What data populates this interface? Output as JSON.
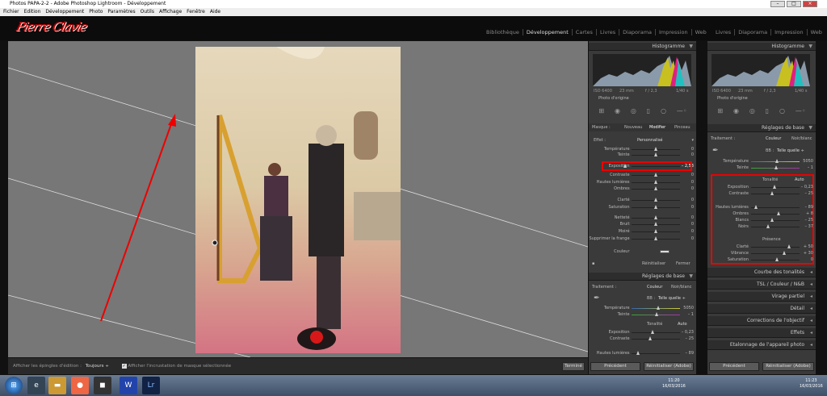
{
  "window": {
    "title": "Photos PAPA-2-2 - Adobe Photoshop Lightroom - Développement"
  },
  "menu": [
    "Fichier",
    "Edition",
    "Développement",
    "Photo",
    "Paramètres",
    "Outils",
    "Affichage",
    "Fenêtre",
    "Aide"
  ],
  "identity": {
    "plate": "Pierre Clavie"
  },
  "modules_left": [
    "Bibliothèque",
    "Développement",
    "Cartes",
    "Livres",
    "Diaporama",
    "Impression",
    "Web"
  ],
  "modules_right": [
    "Livres",
    "Diaporama",
    "Impression",
    "Web"
  ],
  "histogram": {
    "title": "Histogramme",
    "iso": "ISO 6400",
    "focal": "23 mm",
    "aperture": "f / 2,3",
    "shutter": "1/40 s",
    "original": "Photo d'origine"
  },
  "mask_panel": {
    "tabs": [
      "Masque :",
      "Nouveau",
      "Modifier",
      "Pinceau"
    ],
    "effect_label": "Effet :",
    "effect_value": "Personnalisé",
    "sliders": [
      {
        "label": "Température",
        "value": "0"
      },
      {
        "label": "Teinte",
        "value": "0"
      },
      {
        "label": "Exposition",
        "value": "– 2,53"
      },
      {
        "label": "Contraste",
        "value": "0"
      },
      {
        "label": "Hautes lumières",
        "value": "0"
      },
      {
        "label": "Ombres",
        "value": "0"
      },
      {
        "label": "Clarté",
        "value": "0"
      },
      {
        "label": "Saturation",
        "value": "0"
      },
      {
        "label": "Netteté",
        "value": "0"
      },
      {
        "label": "Bruit",
        "value": "0"
      },
      {
        "label": "Moiré",
        "value": "0"
      },
      {
        "label": "Supprimer la frange",
        "value": "0"
      }
    ],
    "couleur": "Couleur",
    "reset": "Réinitialiser",
    "close": "Fermer"
  },
  "basic_left": {
    "title": "Réglages de base",
    "treatment": "Traitement :",
    "color": "Couleur",
    "bw": "Noir/blanc",
    "wb_label": "BB :",
    "wb_value": "Telle quelle ÷",
    "temp_label": "Température",
    "temp_value": "5050",
    "tint_label": "Teinte",
    "tint_value": "– 1",
    "tone": "Tonalité",
    "auto": "Auto",
    "expo_label": "Exposition",
    "expo_value": "– 0,23",
    "contrast_label": "Contraste",
    "contrast_value": "– 25",
    "highlights_label": "Hautes lumières",
    "highlights_value": "– 89"
  },
  "basic_right": {
    "title": "Réglages de base",
    "treatment": "Traitement :",
    "color": "Couleur",
    "bw": "Noir/blanc",
    "wb_label": "BB :",
    "wb_value": "Telle quelle ÷",
    "temp_label": "Température",
    "temp_value": "5050",
    "tint_label": "Teinte",
    "tint_value": "– 1",
    "tone": "Tonalité",
    "auto": "Auto",
    "sliders": [
      {
        "label": "Exposition",
        "value": "– 0,23",
        "pos": 0.45
      },
      {
        "label": "Contraste",
        "value": "– 25",
        "pos": 0.4
      },
      {
        "label": "Hautes lumières",
        "value": "– 89",
        "pos": 0.08
      },
      {
        "label": "Ombres",
        "value": "+ 8",
        "pos": 0.54
      },
      {
        "label": "Blancs",
        "value": "– 25",
        "pos": 0.4
      },
      {
        "label": "Noirs",
        "value": "– 37",
        "pos": 0.32
      }
    ],
    "presence": "Présence",
    "presence_sliders": [
      {
        "label": "Clarté",
        "value": "+ 50",
        "pos": 0.75
      },
      {
        "label": "Vibrance",
        "value": "+ 30",
        "pos": 0.65
      },
      {
        "label": "Saturation",
        "value": "0",
        "pos": 0.5
      }
    ],
    "sections": [
      "Courbe des tonalités",
      "TSL / Couleur / N&B",
      "Virage partiel",
      "Détail",
      "Corrections de l'objectif",
      "Effets",
      "Etalonnage de l'appareil photo"
    ]
  },
  "buttons": {
    "previous": "Précédent",
    "reset": "Réinitialiser (Adobe)",
    "reset_left": "Réinitialiser"
  },
  "toolbar": {
    "show_pins_label": "Afficher les épingles d'édition :",
    "show_pins_value": "Toujours ÷",
    "overlay_label": "Afficher l'incrustation de masque sélectionnée",
    "done": "Terminé"
  },
  "taskbar": {
    "time1": "11:20",
    "date1": "16/03/2016",
    "time2": "11:23",
    "date2": "16/03/2016"
  },
  "colors": {
    "accent_red": "#e00000",
    "panel": "#3a3a3a",
    "canvas": "#777777"
  }
}
